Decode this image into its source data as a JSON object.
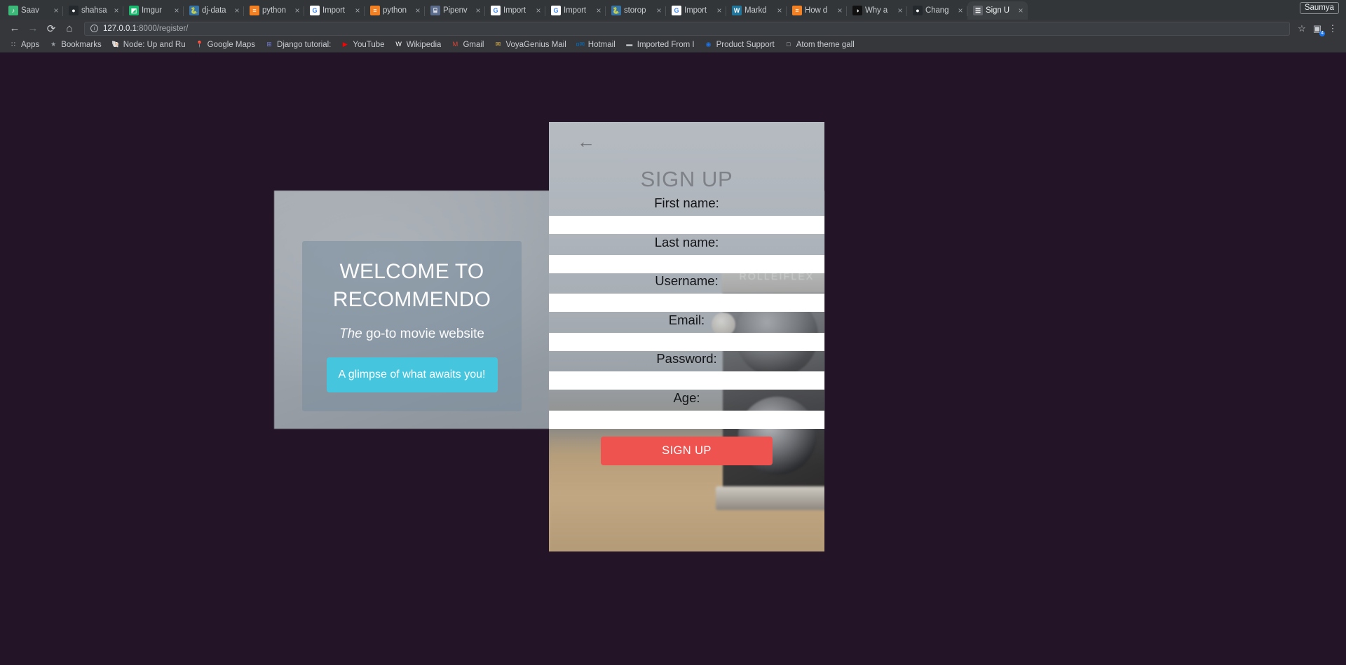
{
  "browser": {
    "tabs": [
      {
        "title": "Saav",
        "icon": "saavn-icon",
        "color": "#3cb878",
        "glyph": "♪",
        "active": false,
        "audio": true
      },
      {
        "title": "shahsa",
        "icon": "github-icon",
        "color": "#24292e",
        "glyph": "●",
        "active": false
      },
      {
        "title": "Imgur",
        "icon": "imgur-icon",
        "color": "#1bb76e",
        "glyph": "◩",
        "active": false
      },
      {
        "title": "dj-data",
        "icon": "python-icon",
        "color": "#3572A5",
        "glyph": "🐍",
        "active": false
      },
      {
        "title": "python",
        "icon": "stackoverflow-icon",
        "color": "#f48024",
        "glyph": "≡",
        "active": false
      },
      {
        "title": "Import",
        "icon": "google-icon",
        "color": "#ffffff",
        "glyph": "G",
        "active": false
      },
      {
        "title": "python",
        "icon": "stackoverflow-icon",
        "color": "#f48024",
        "glyph": "≡",
        "active": false
      },
      {
        "title": "Pipenv",
        "icon": "docs-icon",
        "color": "#5b6b8c",
        "glyph": "⌸",
        "active": false
      },
      {
        "title": "Import",
        "icon": "google-icon",
        "color": "#ffffff",
        "glyph": "G",
        "active": false
      },
      {
        "title": "Import",
        "icon": "google-icon",
        "color": "#ffffff",
        "glyph": "G",
        "active": false
      },
      {
        "title": "storop",
        "icon": "python-icon",
        "color": "#3572A5",
        "glyph": "🐍",
        "active": false
      },
      {
        "title": "Import",
        "icon": "google-icon",
        "color": "#ffffff",
        "glyph": "G",
        "active": false
      },
      {
        "title": "Markd",
        "icon": "wordpress-icon",
        "color": "#21759b",
        "glyph": "W",
        "active": false
      },
      {
        "title": "How d",
        "icon": "stackoverflow-icon",
        "color": "#f48024",
        "glyph": "≡",
        "active": false
      },
      {
        "title": "Why a",
        "icon": "generic-icon",
        "color": "#111111",
        "glyph": "◑",
        "active": false
      },
      {
        "title": "Chang",
        "icon": "github-icon",
        "color": "#24292e",
        "glyph": "●",
        "active": false
      },
      {
        "title": "Sign U",
        "icon": "page-icon",
        "color": "#5f6368",
        "glyph": "☰",
        "active": true
      }
    ],
    "profile_label": "Saumya",
    "nav": {
      "back": "←",
      "forward": "→",
      "reload": "⟳",
      "home": "⌂"
    },
    "omnibox": {
      "info_glyph": "i",
      "url_host": "127.0.0.1",
      "url_path": ":8000/register/"
    },
    "toolbar_icons": [
      {
        "name": "bookmark-star-icon",
        "glyph": "☆"
      },
      {
        "name": "extension-icon",
        "glyph": "▣",
        "badge": "4"
      },
      {
        "name": "menu-icon",
        "glyph": "⋮"
      }
    ],
    "bookmarks": [
      {
        "label": "Apps",
        "icon": "apps-grid-icon",
        "color": "#e8eaed",
        "glyph": "∷"
      },
      {
        "label": "Bookmarks",
        "icon": "star-icon",
        "color": "#9aa0a6",
        "glyph": "★"
      },
      {
        "label": "Node: Up and Ru",
        "icon": "oreilly-icon",
        "color": "#cfd3d7",
        "glyph": "🐚"
      },
      {
        "label": "Google Maps",
        "icon": "maps-icon",
        "color": "#34a853",
        "glyph": "📍"
      },
      {
        "label": "Django tutorial:",
        "icon": "django-icon",
        "color": "#6f7ad3",
        "glyph": "⊞"
      },
      {
        "label": "YouTube",
        "icon": "youtube-icon",
        "color": "#ff0000",
        "glyph": "▶"
      },
      {
        "label": "Wikipedia",
        "icon": "wikipedia-icon",
        "color": "#ffffff",
        "glyph": "W"
      },
      {
        "label": "Gmail",
        "icon": "gmail-icon",
        "color": "#ea4335",
        "glyph": "M"
      },
      {
        "label": "VoyaGenius Mail",
        "icon": "mail-icon",
        "color": "#f2c14e",
        "glyph": "✉"
      },
      {
        "label": "Hotmail",
        "icon": "outlook-icon",
        "color": "#0072c6",
        "glyph": "o✉"
      },
      {
        "label": "Imported From I",
        "icon": "folder-icon",
        "color": "#b8bcc0",
        "glyph": "▬"
      },
      {
        "label": "Product Support",
        "icon": "support-icon",
        "color": "#1a73e8",
        "glyph": "◉"
      },
      {
        "label": "Atom theme gall",
        "icon": "page-icon",
        "color": "#c7cbcf",
        "glyph": "□"
      }
    ]
  },
  "page": {
    "welcome": {
      "title": "WELCOME TO RECOMMENDO",
      "subtitle_em": "The",
      "subtitle_rest": " go-to movie website",
      "cta_label": "A glimpse of what awaits you!",
      "cta_color": "#45c6de"
    },
    "signup": {
      "back_glyph": "←",
      "title": "SIGN UP",
      "fields": [
        {
          "label": "First name:",
          "name": "first-name",
          "value": "",
          "type": "text"
        },
        {
          "label": "Last name:",
          "name": "last-name",
          "value": "",
          "type": "text"
        },
        {
          "label": "Username:",
          "name": "username",
          "value": "",
          "type": "text"
        },
        {
          "label": "Email:",
          "name": "email",
          "value": "",
          "type": "email"
        },
        {
          "label": "Password:",
          "name": "password",
          "value": "",
          "type": "password"
        },
        {
          "label": "Age:",
          "name": "age",
          "value": "",
          "type": "text"
        }
      ],
      "submit_label": "SIGN UP",
      "submit_color": "#ef5350",
      "camera_brand": "ROLLEIFLEX"
    }
  }
}
